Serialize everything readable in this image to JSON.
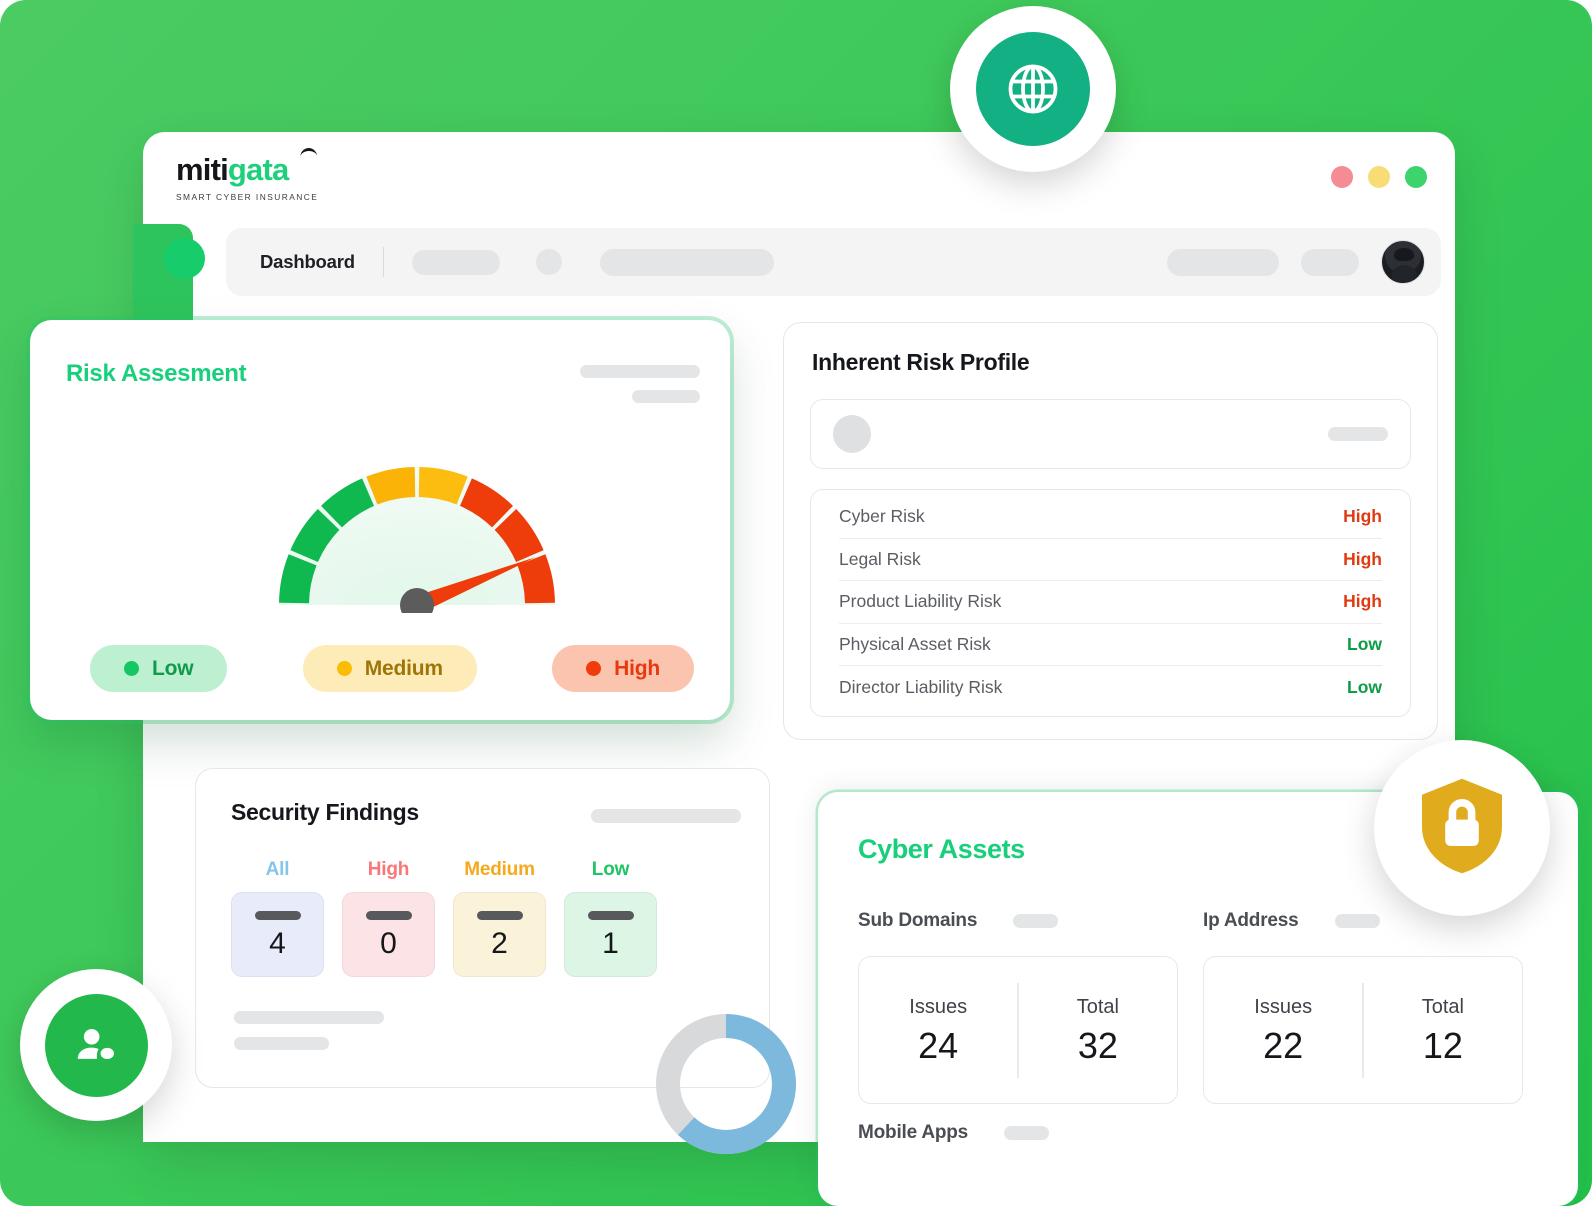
{
  "brand": {
    "logo_main": "miti",
    "logo_accent": "gata",
    "tagline": "SMART CYBER INSURANCE",
    "accent_green": "#18d07c",
    "background_green": "#3ec95a"
  },
  "window": {
    "dots": [
      {
        "name": "close",
        "color": "#f58b94"
      },
      {
        "name": "minimize",
        "color": "#f8dd77"
      },
      {
        "name": "maximize",
        "color": "#3dd46e"
      }
    ]
  },
  "navbar": {
    "active_item": "Dashboard"
  },
  "risk_assessment": {
    "title": "Risk Assesment",
    "legend": [
      {
        "label": "Low",
        "dot": "#15c762",
        "bg": "#bdf0d0",
        "fg": "#119a4b"
      },
      {
        "label": "Medium",
        "dot": "#fbbc06",
        "bg": "#fdecb8",
        "fg": "#a07508"
      },
      {
        "label": "High",
        "dot": "#f03b0d",
        "bg": "#fbc4ae",
        "fg": "#e8380f"
      }
    ],
    "gauge": {
      "needle_level": "High",
      "needle_angle_deg": 22,
      "segments": [
        {
          "band": "Low",
          "color": "#0fb94f"
        },
        {
          "band": "Low",
          "color": "#0fb94f"
        },
        {
          "band": "Low",
          "color": "#0fb94f"
        },
        {
          "band": "Medium",
          "color": "#fbb307"
        },
        {
          "band": "Medium",
          "color": "#fcbd10"
        },
        {
          "band": "High",
          "color": "#ef3c0b"
        },
        {
          "band": "High",
          "color": "#ef3c0b"
        },
        {
          "band": "High",
          "color": "#ef3c0b"
        }
      ]
    }
  },
  "inherent_risk_profile": {
    "title": "Inherent Risk Profile",
    "rows": [
      {
        "label": "Cyber Risk",
        "value": "High",
        "severity": "high"
      },
      {
        "label": "Legal Risk",
        "value": "High",
        "severity": "high"
      },
      {
        "label": "Product Liability Risk",
        "value": "High",
        "severity": "high"
      },
      {
        "label": "Physical Asset Risk",
        "value": "Low",
        "severity": "low"
      },
      {
        "label": "Director Liability Risk",
        "value": "Low",
        "severity": "low"
      }
    ]
  },
  "security_findings": {
    "title": "Security Findings",
    "tiles": [
      {
        "category": "All",
        "count": "4",
        "cat_color": "#86c5e8",
        "tile_bg": "#e7ebfa"
      },
      {
        "category": "High",
        "count": "0",
        "cat_color": "#f8787a",
        "tile_bg": "#fbe3e6"
      },
      {
        "category": "Medium",
        "count": "2",
        "cat_color": "#f5a91c",
        "tile_bg": "#fbf2da"
      },
      {
        "category": "Low",
        "count": "1",
        "cat_color": "#21c364",
        "tile_bg": "#dcf5e4"
      }
    ],
    "donut": {
      "percent": 62,
      "fill_color": "#7cb9dd",
      "track_color": "#d8d9da"
    }
  },
  "cyber_assets": {
    "title": "Cyber Assets",
    "groups": [
      {
        "name": "Sub Domains",
        "cells": [
          {
            "label": "Issues",
            "value": "24"
          },
          {
            "label": "Total",
            "value": "32"
          }
        ]
      },
      {
        "name": "Ip Address",
        "cells": [
          {
            "label": "Issues",
            "value": "22"
          },
          {
            "label": "Total",
            "value": "12"
          }
        ]
      }
    ],
    "mobile_apps_label": "Mobile Apps"
  },
  "badges": [
    {
      "icon": "globe-icon",
      "circle_color": "#13b083"
    },
    {
      "icon": "users-icon",
      "circle_color": "#22b84c"
    },
    {
      "icon": "shield-lock-icon",
      "color": "#e0ac1e"
    }
  ]
}
